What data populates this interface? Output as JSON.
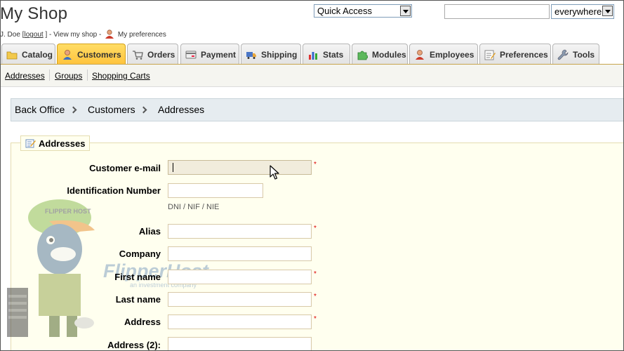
{
  "header": {
    "shop_title": "My Shop",
    "user_prefix": "J. Doe [",
    "logout_label": "logout",
    "user_mid": "] - View my shop -",
    "preferences_label": "My preferences",
    "quick_access_label": "Quick Access",
    "search_value": "",
    "search_scope": "everywhere"
  },
  "tabs": [
    {
      "label": "Catalog",
      "icon": "folder-icon"
    },
    {
      "label": "Customers",
      "icon": "user-icon",
      "active": true
    },
    {
      "label": "Orders",
      "icon": "cart-icon"
    },
    {
      "label": "Payment",
      "icon": "payment-icon"
    },
    {
      "label": "Shipping",
      "icon": "truck-icon"
    },
    {
      "label": "Stats",
      "icon": "bar-chart-icon"
    },
    {
      "label": "Modules",
      "icon": "puzzle-icon"
    },
    {
      "label": "Employees",
      "icon": "employee-icon"
    },
    {
      "label": "Preferences",
      "icon": "preferences-icon"
    },
    {
      "label": "Tools",
      "icon": "wrench-icon"
    }
  ],
  "subnav": [
    "Addresses",
    "Groups",
    "Shopping Carts"
  ],
  "breadcrumb": [
    "Back Office",
    "Customers",
    "Addresses"
  ],
  "form": {
    "legend": "Addresses",
    "required_marker": "*",
    "fields": {
      "email": {
        "label": "Customer e-mail",
        "value": ""
      },
      "idnum": {
        "label": "Identification Number",
        "value": "",
        "hint": "DNI / NIF / NIE"
      },
      "alias": {
        "label": "Alias",
        "value": ""
      },
      "company": {
        "label": "Company",
        "value": ""
      },
      "firstname": {
        "label": "First name",
        "value": ""
      },
      "lastname": {
        "label": "Last name",
        "value": ""
      },
      "address": {
        "label": "Address",
        "value": ""
      },
      "address2": {
        "label": "Address (2):",
        "value": ""
      }
    }
  },
  "watermark": {
    "brand": "FlipperHost",
    "tagline": "an investment company",
    "cap_text": "FLIPPER HOST"
  },
  "colors": {
    "active_tab": "#ffc23a",
    "fieldset_bg": "#ffffef",
    "breadcrumb_bg": "#e6ecf0",
    "required": "#dd0000"
  }
}
